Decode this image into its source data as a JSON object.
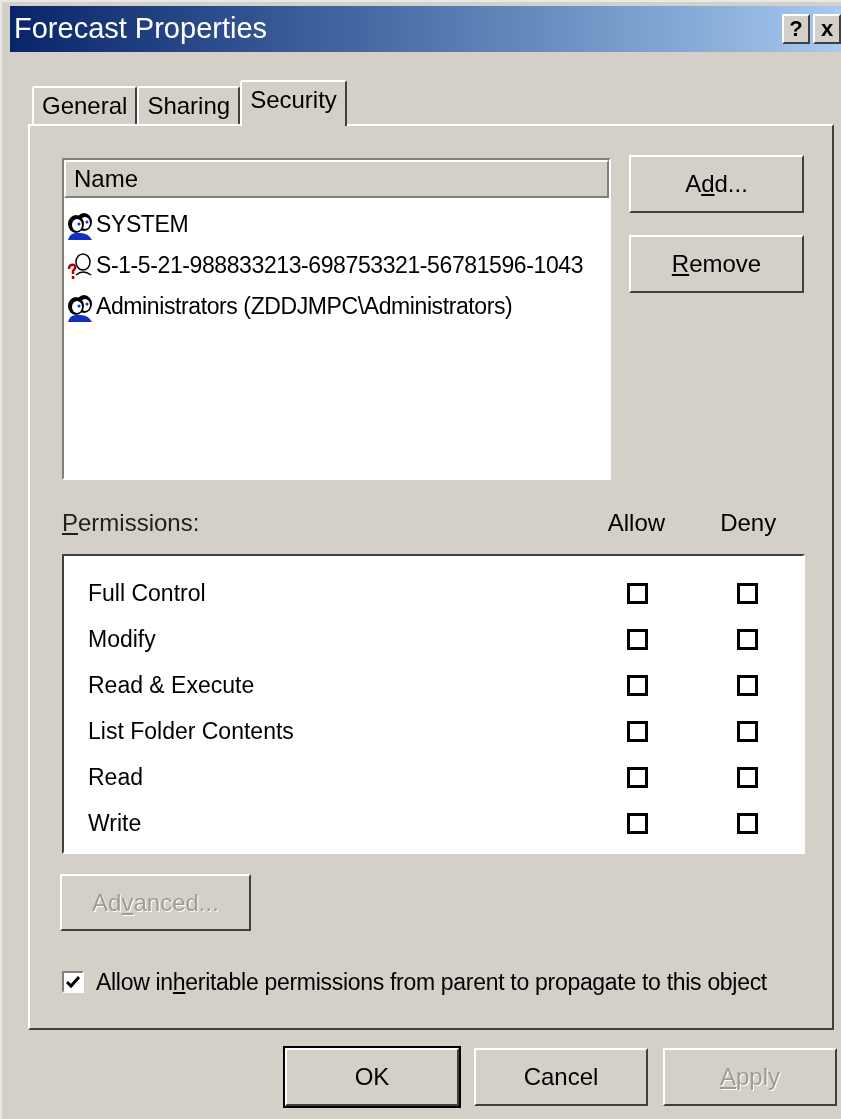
{
  "window": {
    "title": "Forecast Properties",
    "title_buttons": [
      "?",
      "x"
    ]
  },
  "tabs": [
    {
      "label": "General",
      "selected": false
    },
    {
      "label": "Sharing",
      "selected": false
    },
    {
      "label": "Security",
      "selected": true
    }
  ],
  "name_list": {
    "header": "Name",
    "items": [
      {
        "name": "SYSTEM",
        "kind": "group"
      },
      {
        "name": "S-1-5-21-988833213-698753321-56781596-1043",
        "kind": "unknown"
      },
      {
        "name": "Administrators (ZDDJMPC\\Administrators)",
        "kind": "group"
      }
    ]
  },
  "side_buttons": [
    {
      "pre": "A",
      "key": "d",
      "post": "d...",
      "disabled": false
    },
    {
      "key": "R",
      "post": "emove",
      "disabled": false
    }
  ],
  "permissions": {
    "label": {
      "key": "P",
      "post": "ermissions:"
    },
    "columns": [
      "Allow",
      "Deny"
    ],
    "rows": [
      {
        "name": "Full Control",
        "allow": false,
        "deny": false
      },
      {
        "name": "Modify",
        "allow": false,
        "deny": false
      },
      {
        "name": "Read & Execute",
        "allow": false,
        "deny": false
      },
      {
        "name": "List Folder Contents",
        "allow": false,
        "deny": false
      },
      {
        "name": "Read",
        "allow": false,
        "deny": false
      },
      {
        "name": "Write",
        "allow": false,
        "deny": false
      }
    ]
  },
  "advanced_button": {
    "pre": "Ad",
    "key": "v",
    "post": "anced...",
    "disabled": true
  },
  "inherit_checkbox": {
    "pre": "Allow in",
    "key": "h",
    "post": "eritable permissions from parent to propagate to this object",
    "checked": true
  },
  "footer_buttons": [
    {
      "pre": "OK",
      "disabled": false,
      "default": true
    },
    {
      "pre": "Cancel",
      "disabled": false,
      "default": false
    },
    {
      "key": "A",
      "post": "pply",
      "disabled": true,
      "default": false
    }
  ]
}
